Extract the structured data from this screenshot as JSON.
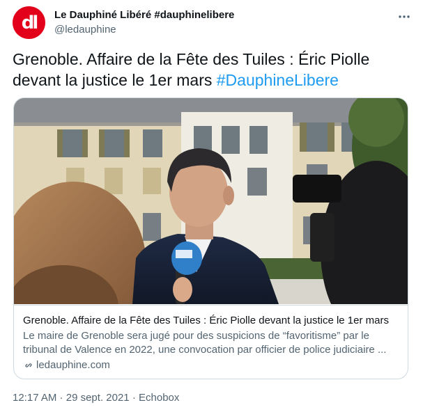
{
  "account": {
    "avatar_text": "dl",
    "display_name": "Le Dauphiné Libéré #dauphinelibere",
    "handle": "@ledauphine"
  },
  "tweet": {
    "text": "Grenoble. Affaire de la Fête des Tuiles : Éric Piolle devant la justice le 1er mars ",
    "hashtag": "#DauphineLibere"
  },
  "card": {
    "title": "Grenoble. Affaire de la Fête des Tuiles : Éric Piolle devant la justice le 1er mars",
    "description": "Le maire de Grenoble sera jugé pour des suspicions de “favoritisme” par le tribunal de Valence en 2022, une convocation par officier de police judiciaire ...",
    "domain": "ledauphine.com",
    "image_alt": "Éric Piolle interviewed in front of building"
  },
  "meta": {
    "time": "12:17 AM",
    "separator": " · ",
    "date": "29 sept. 2021",
    "source": "Echobox"
  },
  "colors": {
    "brand": "#e2001a",
    "link": "#1d9bf0",
    "secondary_text": "#536471",
    "border": "#cfd9de"
  }
}
